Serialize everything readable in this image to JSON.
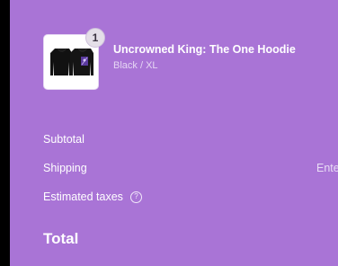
{
  "order_summary": {
    "item": {
      "quantity": "1",
      "title": "Uncrowned King: The One Hoodie",
      "variant": "Black / XL"
    },
    "lines": {
      "subtotal_label": "Subtotal",
      "shipping_label": "Shipping",
      "shipping_value": "Ente",
      "taxes_label": "Estimated taxes",
      "help_icon": "?"
    },
    "total_label": "Total"
  },
  "colors": {
    "panel_bg": "#a974d6",
    "outer_bg": "#000000",
    "text": "#ffffff"
  },
  "icons": {
    "help": "question-circle-icon"
  }
}
